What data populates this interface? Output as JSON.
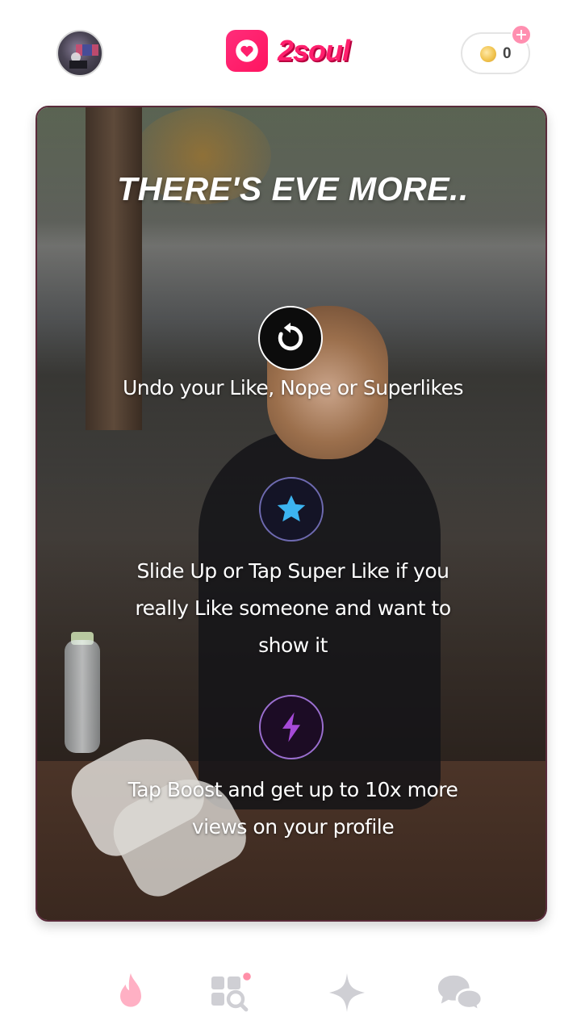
{
  "header": {
    "logo_text": "2soul",
    "coin_balance": "0"
  },
  "card": {
    "headline": "THERE'S EVE MORE..",
    "features": [
      {
        "icon": "undo-icon",
        "text": "Undo your Like, Nope or Superlikes"
      },
      {
        "icon": "star-icon",
        "text": "Slide Up or Tap Super Like if you really Like someone and want to show it"
      },
      {
        "icon": "bolt-icon",
        "text": "Tap Boost and get up to 10x more views on your profile"
      }
    ]
  },
  "nav": {
    "items": [
      {
        "icon": "flame-icon",
        "active": true
      },
      {
        "icon": "explore-icon",
        "badge": true
      },
      {
        "icon": "sparkle-icon",
        "active": false
      },
      {
        "icon": "chat-icon",
        "active": false
      }
    ]
  },
  "colors": {
    "brand": "#ff1f6d",
    "star": "#3cb4f0",
    "boost": "#a64ad8",
    "nav_inactive": "#cfcfd4",
    "nav_active": "#ffb0c4"
  }
}
